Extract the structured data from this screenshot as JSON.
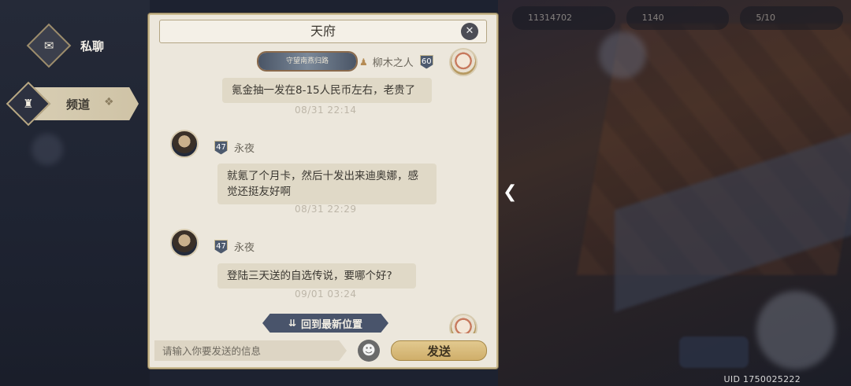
{
  "sidebar": {
    "tabs": [
      {
        "label": "私聊",
        "icon": "chat-bubble-icon"
      },
      {
        "label": "频道",
        "icon": "chess-rook-icon"
      }
    ]
  },
  "panel": {
    "title": "天府",
    "messages": [
      {
        "sender": "柳木之人",
        "level": "60",
        "frame_text": "守望南燕归路",
        "text": "氪金抽一发在8-15人民币左右，老贵了",
        "time": "08/31  22:14"
      },
      {
        "sender": "永夜",
        "level": "47",
        "text": "就氪了个月卡，然后十发出来迪奥娜，感觉还挺友好啊",
        "time": "08/31  22:29"
      },
      {
        "sender": "永夜",
        "level": "47",
        "text": "登陆三天送的自选传说，要哪个好?",
        "time": "09/01  03:24"
      }
    ],
    "jump_label": "回到最新位置",
    "input_placeholder": "请输入你要发送的信息",
    "send_label": "发送"
  },
  "background": {
    "resources": [
      "11314702",
      "1140",
      "5/10"
    ],
    "uid": "UID 1750025222"
  }
}
